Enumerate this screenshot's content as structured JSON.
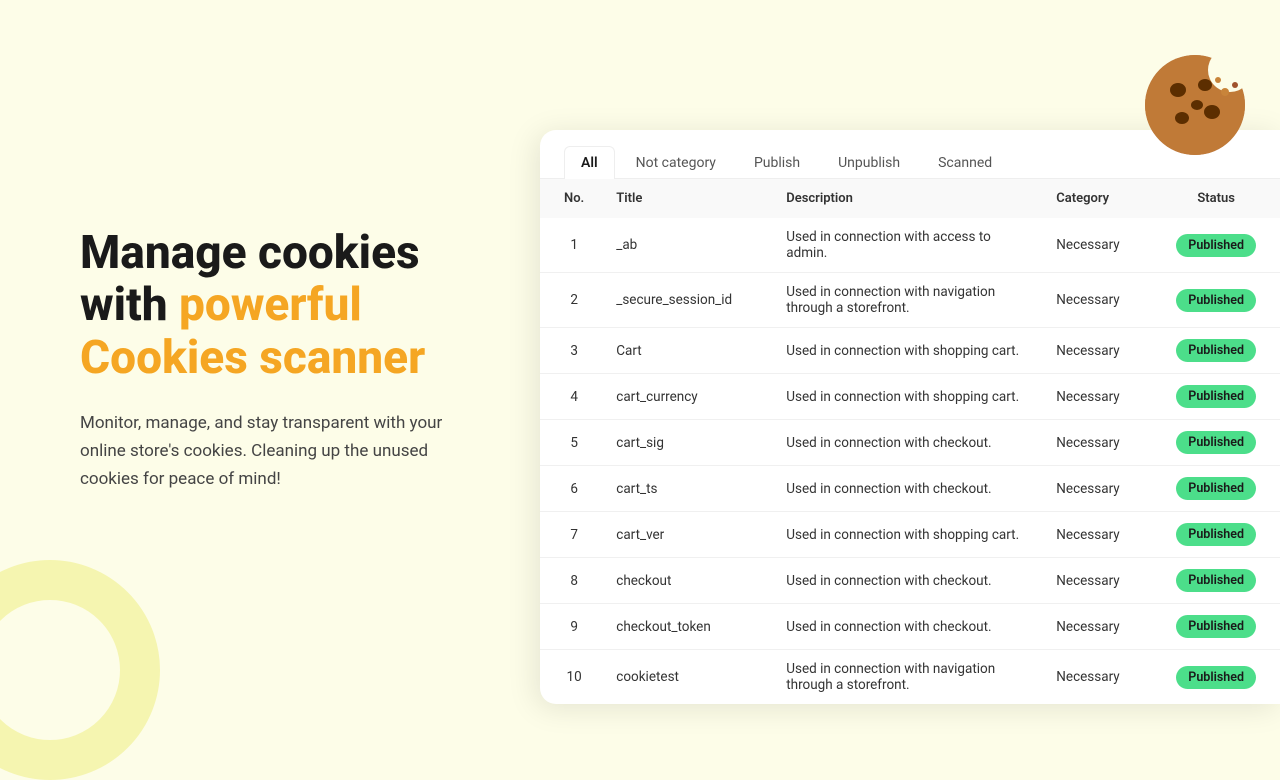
{
  "page": {
    "background_color": "#fdfde8"
  },
  "left": {
    "headline_part1": "Manage cookies",
    "headline_part2": "with ",
    "headline_highlight": "powerful",
    "headline_part3": "Cookies scanner",
    "subtext": "Monitor, manage, and stay transparent with your online store's cookies. Cleaning up the unused cookies for peace of mind!"
  },
  "tabs": [
    {
      "label": "All",
      "active": true
    },
    {
      "label": "Not category",
      "active": false
    },
    {
      "label": "Publish",
      "active": false
    },
    {
      "label": "Unpublish",
      "active": false
    },
    {
      "label": "Scanned",
      "active": false
    }
  ],
  "table": {
    "columns": [
      "No.",
      "Title",
      "Description",
      "Category",
      "Status"
    ],
    "rows": [
      {
        "no": 1,
        "title": "_ab",
        "description": "Used in connection with access to admin.",
        "category": "Necessary",
        "status": "Published"
      },
      {
        "no": 2,
        "title": "_secure_session_id",
        "description": "Used in connection with navigation through a storefront.",
        "category": "Necessary",
        "status": "Published"
      },
      {
        "no": 3,
        "title": "Cart",
        "description": "Used in connection with shopping cart.",
        "category": "Necessary",
        "status": "Published"
      },
      {
        "no": 4,
        "title": "cart_currency",
        "description": "Used in connection with shopping cart.",
        "category": "Necessary",
        "status": "Published"
      },
      {
        "no": 5,
        "title": "cart_sig",
        "description": "Used in connection with checkout.",
        "category": "Necessary",
        "status": "Published"
      },
      {
        "no": 6,
        "title": "cart_ts",
        "description": "Used in connection with checkout.",
        "category": "Necessary",
        "status": "Published"
      },
      {
        "no": 7,
        "title": "cart_ver",
        "description": "Used in connection with shopping cart.",
        "category": "Necessary",
        "status": "Published"
      },
      {
        "no": 8,
        "title": "checkout",
        "description": "Used in connection with checkout.",
        "category": "Necessary",
        "status": "Published"
      },
      {
        "no": 9,
        "title": "checkout_token",
        "description": "Used in connection with checkout.",
        "category": "Necessary",
        "status": "Published"
      },
      {
        "no": 10,
        "title": "cookietest",
        "description": "Used in connection with navigation through a storefront.",
        "category": "Necessary",
        "status": "Published"
      }
    ]
  },
  "status_color": "#4cde8a",
  "accent_color": "#f5a623"
}
